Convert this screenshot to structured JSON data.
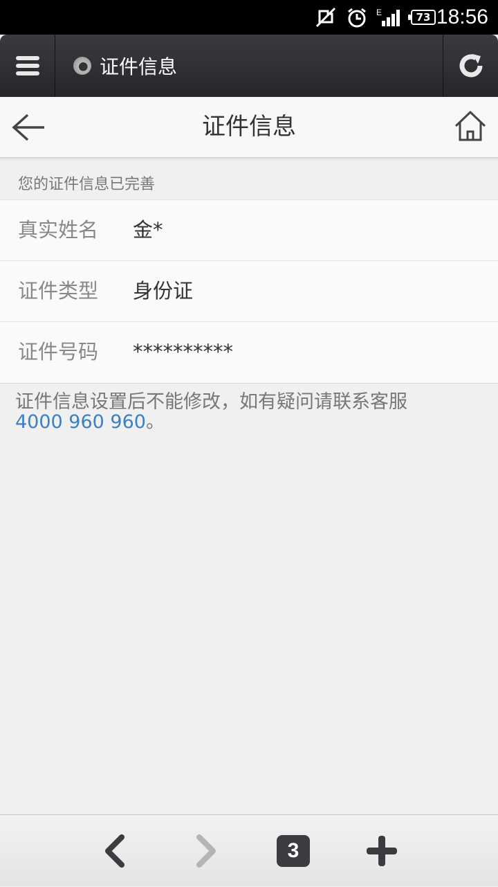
{
  "status_bar": {
    "time": "18:56",
    "battery": "73",
    "network_type": "E"
  },
  "browser": {
    "tab_title": "证件信息",
    "open_tabs": "3"
  },
  "header": {
    "title": "证件信息"
  },
  "notice": "您的证件信息已完善",
  "fields": [
    {
      "label": "真实姓名",
      "value": "金*"
    },
    {
      "label": "证件类型",
      "value": "身份证"
    },
    {
      "label": "证件号码",
      "value": "**********"
    }
  ],
  "hint": {
    "text": "证件信息设置后不能修改，如有疑问请联系客服",
    "phone": "4000 960 960",
    "suffix": "。"
  },
  "colors": {
    "link": "#3b7fc4",
    "browser_bar": "#2f3034"
  }
}
